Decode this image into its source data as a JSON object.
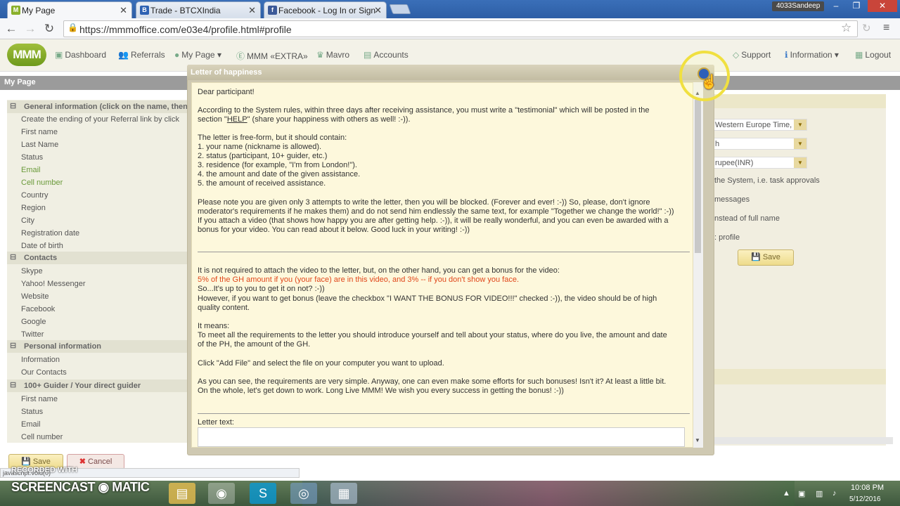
{
  "browser": {
    "tabs": [
      {
        "title": "My Page",
        "favicon": "M"
      },
      {
        "title": "Trade - BTCXIndia",
        "favicon": "B"
      },
      {
        "title": "Facebook - Log In or Sign",
        "favicon": "f"
      }
    ],
    "user_badge": "4033Sandeep",
    "url": "https://mmmoffice.com/e03e4/profile.html#profile"
  },
  "site_nav": {
    "logo": "MMM",
    "items": [
      "Dashboard",
      "Referrals",
      "My Page",
      "MMM «EXTRA»",
      "Mavro",
      "Accounts"
    ],
    "right_items": [
      "Support",
      "Information",
      "Logout"
    ],
    "page_title": "My Page"
  },
  "left_panel": {
    "section_general": "General information (click on the name, then",
    "general_rows": [
      "Create the ending of your Referral link by click",
      "First name",
      "Last Name",
      "Status",
      "Email",
      "Cell number",
      "Country",
      "Region",
      "City",
      "Registration date",
      "Date of birth"
    ],
    "section_contacts": "Contacts",
    "contact_rows": [
      "Skype",
      "Yahoo! Messenger",
      "Website",
      "Facebook",
      "Google",
      "Twitter"
    ],
    "section_personal": "Personal information",
    "personal_rows": [
      "Information",
      "Our Contacts"
    ],
    "section_guider": "100+ Guider / Your direct guider",
    "guider_rows": [
      "First name",
      "Status",
      "Email",
      "Cell number"
    ],
    "save_label": "Save",
    "cancel_label": "Cancel",
    "status_url": "javascript:void(0)"
  },
  "right_panel": {
    "timezone": "Western Europe Time,",
    "lang": "h",
    "currency": "rupee(INR)",
    "text1": "the System, i.e. task approvals",
    "text2": "messages",
    "text3": "nstead of full name",
    "text4": ": profile",
    "save_label": "Save"
  },
  "modal": {
    "title": "Letter of happiness",
    "greeting": "Dear participant!",
    "p1_line1": "According to the System rules, within three days after receiving assistance, you must write a \"testimonial\" which will be posted in the",
    "p1_line2_a": "section \"",
    "p1_help": "HELP",
    "p1_line2_b": "\" (share your happiness with others as well! :-)).",
    "p2_intro": "The letter is free-form, but it should contain:",
    "p2_items": [
      "1. your name (nickname is allowed).",
      "2. status (participant, 10+ guider, etc.)",
      "3. residence (for example, \"I'm from London!\").",
      "4. the amount and date of the given assistance.",
      "5. the amount of received assistance."
    ],
    "p3_lines": [
      "Please note you are given only 3 attempts to write the letter, then you will be blocked. (Forever and ever! :-)) So, please, don't ignore",
      "moderator's requirements if he makes them) and do not send him endlessly the same text, for example \"Together we change the world!\" :-))",
      "If you attach a video (that shows how happy you are after getting help. :-)), it will be really wonderful, and you can even be awarded with a",
      "bonus for your video. You can read about it below. Good luck in your writing! :-))"
    ],
    "p4_line1": "It is not required to attach the video to the letter, but, on the other hand, you can get a bonus for the video:",
    "p4_red": "5% of the GH amount if you (your face) are in this video, and 3% -- if you don't show you face.",
    "p4_line3": "So...It's up to you to get it on not? :-))",
    "p4_line4": "However, if you want to get bonus (leave the checkbox \"I WANT THE BONUS FOR VIDEO!!!\" checked :-)), the video should be of high",
    "p4_line5": "quality content.",
    "p5_intro": "It means:",
    "p5_line1": "To meet all the requirements to the letter you should introduce yourself and tell about your status, where do you live, the amount and date",
    "p5_line2": "of the PH, the amount of the GH.",
    "p6": "Click \"Add File\" and select the file on your computer you want to upload.",
    "p7_line1": "As you can see, the requirements are very simple. Anyway, one can even make some efforts for such bonuses! Isn't it? At least a little bit.",
    "p7_line2": "On the whole, let's get down to work. Long Live MMM! We wish you every success in getting the bonus! :-))",
    "letter_label": "Letter text:"
  },
  "watermark": {
    "recorded": "RECORDED WITH",
    "brand_a": "SCREENCAST",
    "brand_b": "MATIC"
  },
  "taskbar": {
    "time": "10:08 PM",
    "date": "5/12/2016"
  }
}
